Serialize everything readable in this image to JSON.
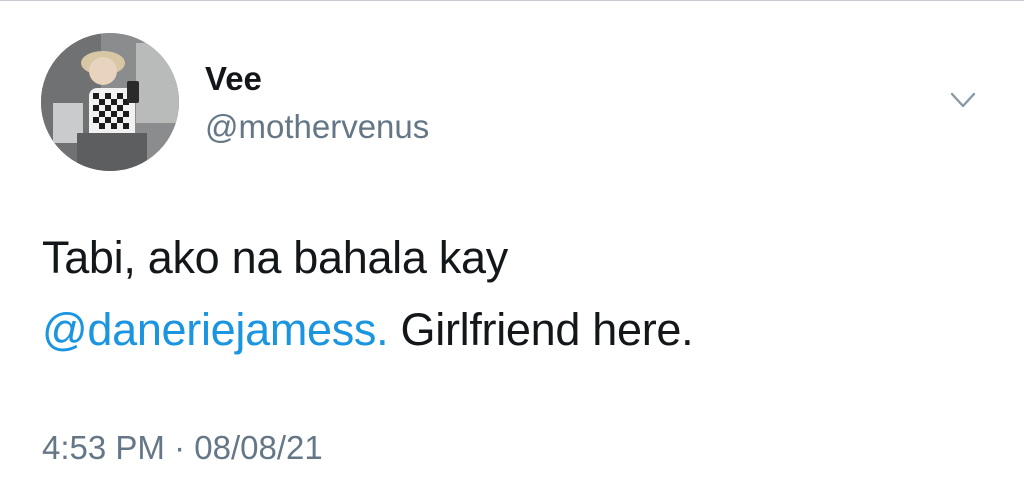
{
  "tweet": {
    "author": {
      "display_name": "Vee",
      "handle": "@mothervenus"
    },
    "text": {
      "line1": "Tabi, ako na bahala kay",
      "mention": "@daneriejamess.",
      "after_mention": " Girlfriend here."
    },
    "meta": {
      "time": "4:53 PM",
      "separator": " · ",
      "date": "08/08/21"
    },
    "icons": {
      "menu": "chevron-down-icon",
      "avatar": "profile-photo"
    },
    "colors": {
      "mention": "#1b95e0",
      "secondary_text": "#657786",
      "primary_text": "#14171a"
    }
  }
}
